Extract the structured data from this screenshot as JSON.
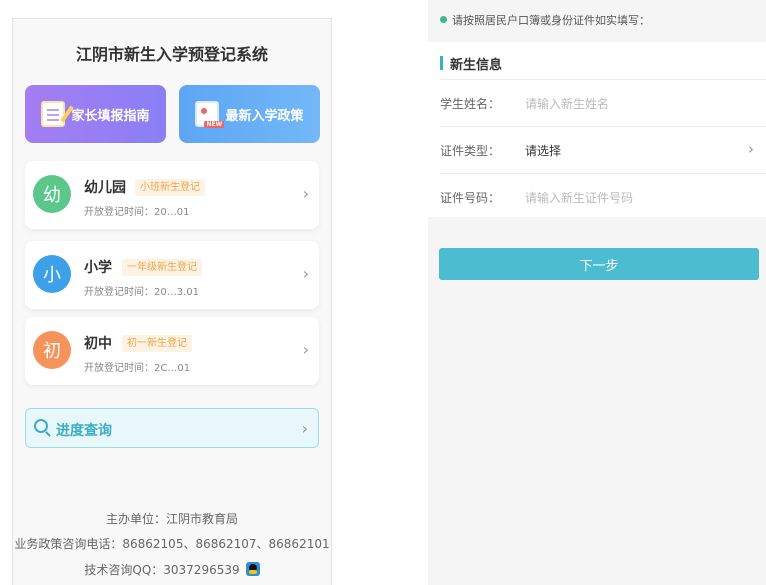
{
  "left_panel": {
    "title": "江阴市新生入学预登记系统",
    "guide_button": "家长填报指南",
    "policy_button": "最新入学政策",
    "cards": [
      {
        "avatar": "幼",
        "name": "幼儿园",
        "tag": "小班新生登记",
        "open_time": "开放登记时间：20…01"
      },
      {
        "avatar": "小",
        "name": "小学",
        "tag": "一年级新生登记",
        "open_time": "开放登记时间：20…3.01"
      },
      {
        "avatar": "初",
        "name": "初中",
        "tag": "初一新生登记",
        "open_time": "开放登记时间：2C…01"
      }
    ],
    "progress_query": "进度查询",
    "footer": {
      "organizer": "主办单位：江阴市教育局",
      "phone": "业务政策咨询电话：86862105、86862107、86862101",
      "qq": "技术咨询QQ：3037296539"
    }
  },
  "right_panel": {
    "notice": "请按照居民户口簿或身份证件如实填写：",
    "section_title": "新生信息",
    "fields": [
      {
        "label": "学生姓名：",
        "value": "请输入新生姓名",
        "kind": "placeholder"
      },
      {
        "label": "证件类型：",
        "value": "请选择",
        "kind": "select"
      },
      {
        "label": "证件号码：",
        "value": "请输入新生证件号码",
        "kind": "placeholder"
      }
    ],
    "next_button": "下一步"
  },
  "icons": {
    "guide": "document-edit-icon",
    "policy": "new-document-icon",
    "search": "search-icon",
    "chevron": "chevron-right-icon",
    "qq": "qq-penguin-icon"
  },
  "colors": {
    "accent": "#4cbcd0",
    "guide_gradient": "#a47df2",
    "policy_gradient": "#5da5f5",
    "kindergarten": "#5bc78b",
    "primary": "#3da0e8",
    "junior": "#f5935b",
    "tag_text": "#f0a44a"
  }
}
